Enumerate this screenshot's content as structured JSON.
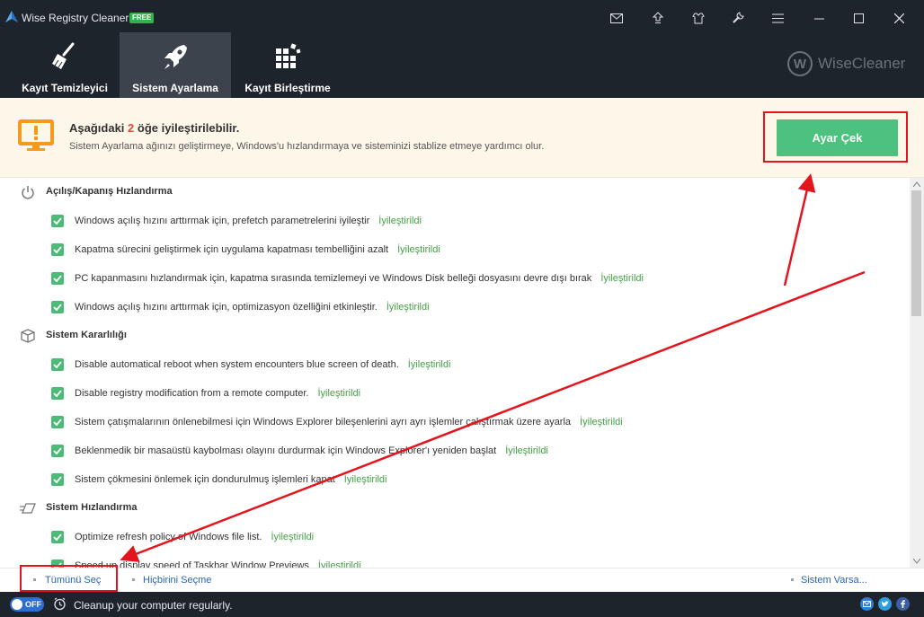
{
  "app": {
    "title": "Wise Registry Cleaner X",
    "badge": "FREE",
    "brand": "WiseCleaner",
    "brand_mark": "W"
  },
  "tabs": [
    {
      "label": "Kayıt Temizleyici",
      "icon": "broom-icon",
      "active": false
    },
    {
      "label": "Sistem Ayarlama",
      "icon": "rocket-icon",
      "active": true
    },
    {
      "label": "Kayıt Birleştirme",
      "icon": "blocks-icon",
      "active": false
    }
  ],
  "titlebar_icons": [
    "mail-icon",
    "upload-icon",
    "tools-icon",
    "menu-icon",
    "minimize-icon",
    "maximize-icon",
    "close-icon"
  ],
  "banner": {
    "title_before": "Aşağıdaki",
    "count": "2",
    "title_after": "öğe iyileştirilebilir.",
    "subtitle": "Sistem Ayarlama ağınızı geliştirmeye, Windows'u hızlandırmaya ve sisteminizi stablize etmeye yardımcı olur.",
    "fix_button": "Ayar Çek"
  },
  "sections": [
    {
      "title": "Açılış/Kapanış Hızlandırma",
      "icon": "power-icon",
      "items": [
        {
          "text": "Windows açılış hızını arttırmak için, prefetch parametrelerini iyileştir",
          "status": "İyileştirildi"
        },
        {
          "text": "Kapatma sürecini geliştirmek için uygulama kapatması tembelliğini azalt",
          "status": "İyileştirildi"
        },
        {
          "text": "PC kapanmasını hızlandırmak için, kapatma sırasında temizlemeyi ve Windows Disk belleği dosyasını devre dışı bırak",
          "status": "İyileştirildi"
        },
        {
          "text": "Windows açılış hızını arttırmak için, optimizasyon özelliğini etkinleştir.",
          "status": "İyileştirildi"
        }
      ]
    },
    {
      "title": "Sistem Kararlılığı",
      "icon": "cube-icon",
      "items": [
        {
          "text": "Disable automatical reboot when system encounters blue screen of death.",
          "status": "İyileştirildi"
        },
        {
          "text": "Disable registry modification from a remote computer.",
          "status": "İyileştirildi"
        },
        {
          "text": "Sistem çatışmalarının önlenebilmesi için Windows Explorer bileşenlerini ayrı ayrı işlemler çalıştırmak üzere ayarla",
          "status": "İyileştirildi"
        },
        {
          "text": "Beklenmedik bir masaüstü kaybolması olayını durdurmak için Windows Explorer'ı yeniden başlat",
          "status": "İyileştirildi"
        },
        {
          "text": "Sistem çökmesini önlemek için dondurulmuş işlemleri kapat",
          "status": "İyileştirildi"
        }
      ]
    },
    {
      "title": "Sistem Hızlandırma",
      "icon": "speed-icon",
      "items": [
        {
          "text": "Optimize refresh policy of Windows file list.",
          "status": "İyileştirildi"
        },
        {
          "text": "Speed up display speed of Taskbar Window Previews",
          "status": "İyileştirildi"
        }
      ]
    }
  ],
  "footer": {
    "select_all": "Tümünü Seç",
    "select_none": "Hiçbirini Seçme",
    "system_default": "Sistem Varsa..."
  },
  "statusbar": {
    "toggle": "OFF",
    "message": "Cleanup your computer regularly.",
    "social": [
      "mail-icon",
      "twitter-icon",
      "facebook-icon"
    ]
  },
  "colors": {
    "header_bg": "#1e242c",
    "active_tab": "#3c434d",
    "accent_green": "#4cc27e",
    "status_green": "#45a048",
    "highlight_red": "#e4141c",
    "banner_bg": "#fdf7e9"
  }
}
